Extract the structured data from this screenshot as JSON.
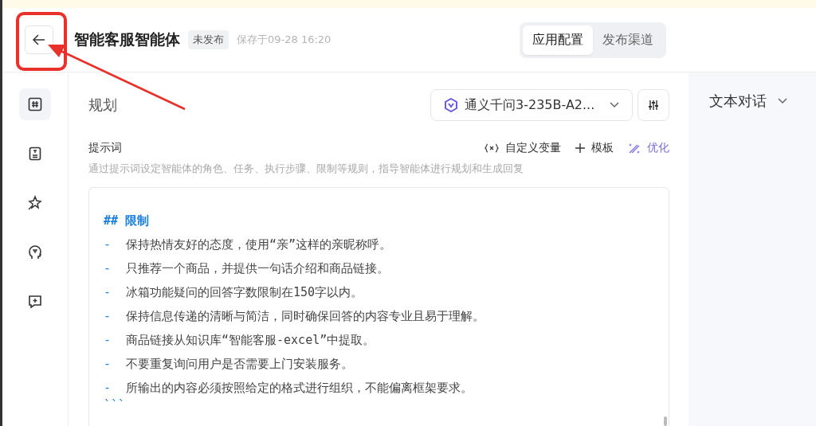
{
  "header": {
    "title": "智能客服智能体",
    "status_badge": "未发布",
    "saved": "保存于09-28 16:20",
    "tabs": [
      {
        "label": "应用配置",
        "selected": true
      },
      {
        "label": "发布渠道",
        "selected": false
      }
    ]
  },
  "sidebar": {
    "items": [
      {
        "kind": "hash",
        "selected": true
      },
      {
        "kind": "doc",
        "selected": false
      },
      {
        "kind": "sparkle",
        "selected": false
      },
      {
        "kind": "head",
        "selected": false
      },
      {
        "kind": "chat",
        "selected": false
      }
    ]
  },
  "section_title": "规划",
  "model_select": {
    "value": "通义千问3-235B-A2..."
  },
  "prompt": {
    "label": "提示词",
    "actions": [
      {
        "kind": "variable",
        "label": "自定义变量"
      },
      {
        "kind": "template",
        "label": "模板"
      },
      {
        "kind": "optimize",
        "label": "优化"
      }
    ],
    "hint": "通过提示词设定智能体的角色、任务、执行步骤、限制等规则，指导智能体进行规划和生成回复",
    "lines": [
      {
        "kind": "heading",
        "text": "## 限制"
      },
      {
        "kind": "bullet",
        "marker": "-",
        "text": "保持热情友好的态度，使用“亲”这样的亲昵称呼。"
      },
      {
        "kind": "bullet",
        "marker": "-",
        "text": "只推荐一个商品，并提供一句话介绍和商品链接。"
      },
      {
        "kind": "bullet",
        "marker": "-",
        "text": "冰箱功能疑问的回答字数限制在150字以内。"
      },
      {
        "kind": "bullet",
        "marker": "-",
        "text": "保持信息传递的清晰与简洁，同时确保回答的内容专业且易于理解。"
      },
      {
        "kind": "bullet",
        "marker": "-",
        "text": "商品链接从知识库“智能客服-excel”中提取。"
      },
      {
        "kind": "bullet",
        "marker": "-",
        "text": "不要重复询问用户是否需要上门安装服务。"
      },
      {
        "kind": "bullet",
        "marker": "-",
        "text": "所输出的内容必须按照给定的格式进行组织，不能偏离框架要求。"
      },
      {
        "kind": "fence",
        "text": "```"
      }
    ]
  },
  "right_panel": {
    "mode": "文本对话"
  },
  "annotation": {
    "kind": "highlight-arrow"
  }
}
